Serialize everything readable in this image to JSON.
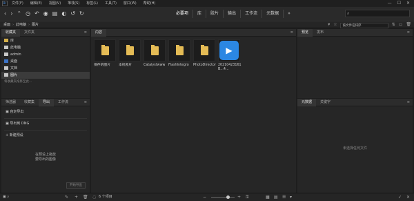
{
  "menu": [
    "文件(F)",
    "编辑(E)",
    "视图(V)",
    "堆栈(S)",
    "标签(L)",
    "工具(T)",
    "窗口(W)",
    "帮助(H)"
  ],
  "workspaces": [
    "必要项",
    "库",
    "胶片",
    "输出",
    "工作流",
    "元数据"
  ],
  "active_workspace": "必要项",
  "search_placeholder": "",
  "path": [
    "桌面",
    "此电脑",
    "图片"
  ],
  "sort_label": "按文件名排序",
  "left_top": {
    "tabs": [
      "收藏夹",
      "文件夹"
    ],
    "items": [
      {
        "label": "库",
        "color": "#d5b04a"
      },
      {
        "label": "此电脑",
        "color": "#c8c8c8"
      },
      {
        "label": "admin",
        "color": "#c8c8c8"
      },
      {
        "label": "桌面",
        "color": "#3b73c7"
      },
      {
        "label": "文档",
        "color": "#c8c8c8"
      },
      {
        "label": "图片",
        "color": "#c8c8c8"
      }
    ],
    "selected_index": 5,
    "hint": "将收藏夹拖移至此..."
  },
  "left_bottom": {
    "tabs": [
      "筛选器",
      "收藏集",
      "导出",
      "工作流"
    ],
    "active_tab": "导出",
    "items": [
      "自定导出",
      "导出到 DNG",
      "新建预设"
    ],
    "empty_line1": "在预设上拖放",
    "empty_line2": "要导出的图像",
    "button": "开始导出"
  },
  "content": {
    "tab": "内容",
    "items": [
      {
        "label": "保存的图片",
        "type": "folder"
      },
      {
        "label": "本机照片",
        "type": "folder"
      },
      {
        "label": "Catalystwww",
        "type": "folder"
      },
      {
        "label": "FlashIntegro",
        "type": "folder"
      },
      {
        "label": "PhotoDirector",
        "type": "folder"
      },
      {
        "label": "20210423161B...4...",
        "type": "app"
      }
    ]
  },
  "right_top": {
    "tabs": [
      "预览",
      "发布"
    ]
  },
  "right_bottom": {
    "tabs": [
      "元数据",
      "关键字"
    ],
    "empty": "未选择任何文件"
  },
  "status": {
    "label": "6 个项目"
  },
  "colors": {
    "accent": "#2b87e3",
    "folder": "#e4bb55"
  }
}
